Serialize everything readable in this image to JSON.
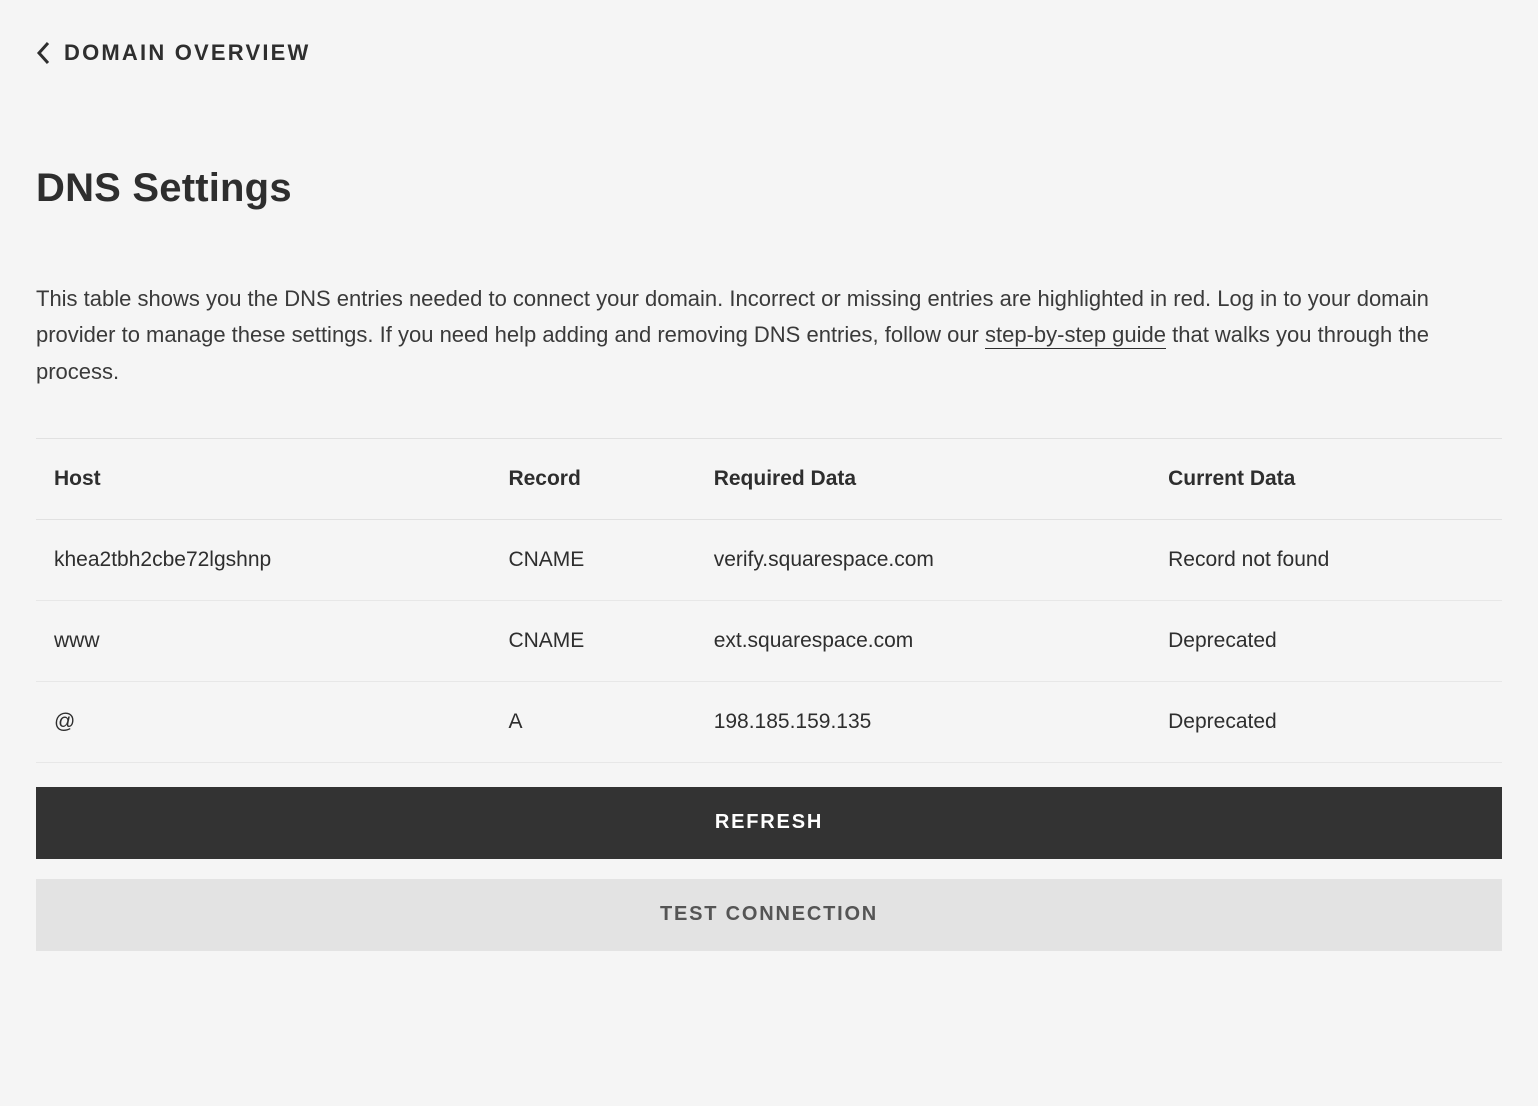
{
  "breadcrumb": {
    "label": "DOMAIN OVERVIEW"
  },
  "page": {
    "title": "DNS Settings",
    "description_pre": "This table shows you the DNS entries needed to connect your domain. Incorrect or missing entries are highlighted in red. Log in to your domain provider to manage these settings. If you need help adding and removing DNS entries, follow our ",
    "description_link": "step-by-step guide",
    "description_post": " that walks you through the process."
  },
  "table": {
    "headers": {
      "host": "Host",
      "record": "Record",
      "required": "Required Data",
      "current": "Current Data"
    },
    "rows": [
      {
        "host": "khea2tbh2cbe72lgshnp",
        "record": "CNAME",
        "record_error": true,
        "required": "verify.squarespace.com",
        "current": "Record not found",
        "current_error": true
      },
      {
        "host": "www",
        "record": "CNAME",
        "record_error": false,
        "required": "ext.squarespace.com",
        "current": "Deprecated",
        "current_error": false
      },
      {
        "host": "@",
        "record": "A",
        "record_error": false,
        "required": "198.185.159.135",
        "current": "Deprecated",
        "current_error": false
      }
    ]
  },
  "actions": {
    "refresh": "REFRESH",
    "test": "TEST CONNECTION"
  },
  "colors": {
    "error": "#d75a4a",
    "primary_btn_bg": "#333333",
    "secondary_btn_bg": "#e3e3e3"
  }
}
